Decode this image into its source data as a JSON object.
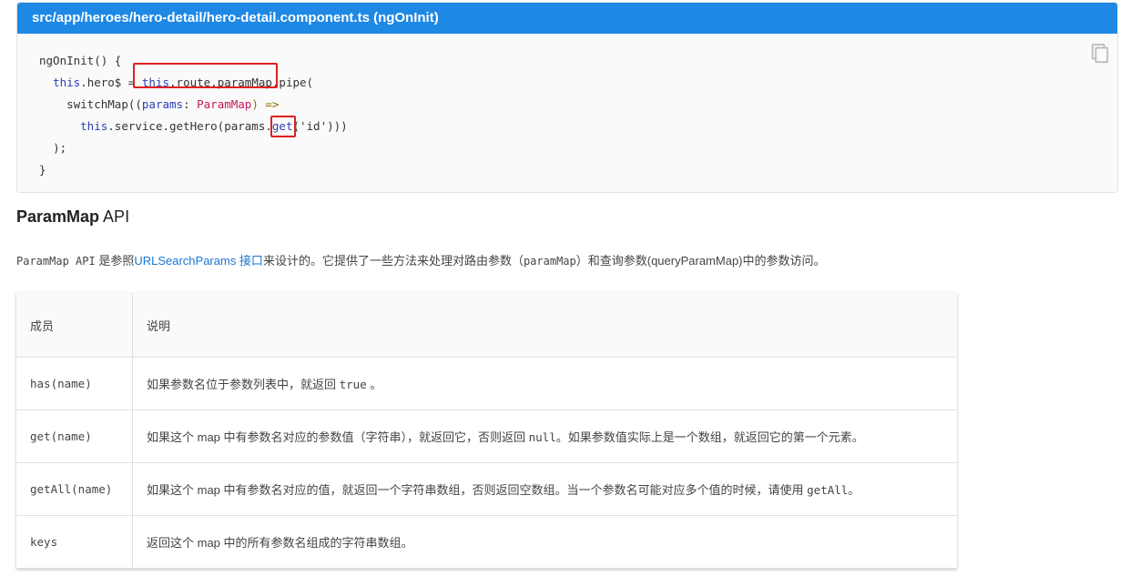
{
  "code_card": {
    "header": "src/app/heroes/hero-detail/hero-detail.component.ts (ngOnInit)",
    "copy_icon": "copy-icon",
    "lines": {
      "l1": "ngOnInit() {",
      "l2_a": "this",
      "l2_b": ".hero$ = ",
      "l2_c": "this",
      "l2_d": ".route.paramMap.pipe(",
      "l3_a": "switchMap((",
      "l3_b": "params",
      "l3_c": ": ",
      "l3_d": "ParamMap",
      "l3_e": ") =>",
      "l4_a": "this",
      "l4_b": ".service.getHero(params.",
      "l4_c": "get",
      "l4_d": "('id')))",
      "l5": ");",
      "l6": "}"
    },
    "highlight_color": "#e02020"
  },
  "section": {
    "title_bold": "ParamMap",
    "title_rest": " API"
  },
  "description": {
    "part1": "ParamMap API",
    "part2": " 是参照",
    "link": "URLSearchParams 接口",
    "part3": "来设计的。它提供了一些方法来处理对路由参数（",
    "part4": "paramMap",
    "part5": "）和查询参数(queryParamMap)中的参数访问。"
  },
  "table": {
    "headers": [
      "成员",
      "说明"
    ],
    "rows": [
      {
        "member": "has(name)",
        "desc_a": "如果参数名位于参数列表中，就返回 ",
        "desc_code": "true",
        "desc_b": " 。"
      },
      {
        "member": "get(name)",
        "desc_a": "如果这个 map 中有参数名对应的参数值（字符串），就返回它，否则返回 ",
        "desc_code": "null",
        "desc_b": "。如果参数值实际上是一个数组，就返回它的第一个元素。"
      },
      {
        "member": "getAll(name)",
        "desc_a": "如果这个 map 中有参数名对应的值，就返回一个字符串数组，否则返回空数组。当一个参数名可能对应多个值的时候，请使用 ",
        "desc_code": "getAll",
        "desc_b": "。"
      },
      {
        "member": "keys",
        "desc_a": "返回这个 map 中的所有参数名组成的字符串数组。",
        "desc_code": "",
        "desc_b": ""
      }
    ]
  },
  "colors": {
    "header_blue": "#1e88e5",
    "link_blue": "#1976d2",
    "keyword": "#2a3fb5",
    "type": "#c2185b"
  }
}
